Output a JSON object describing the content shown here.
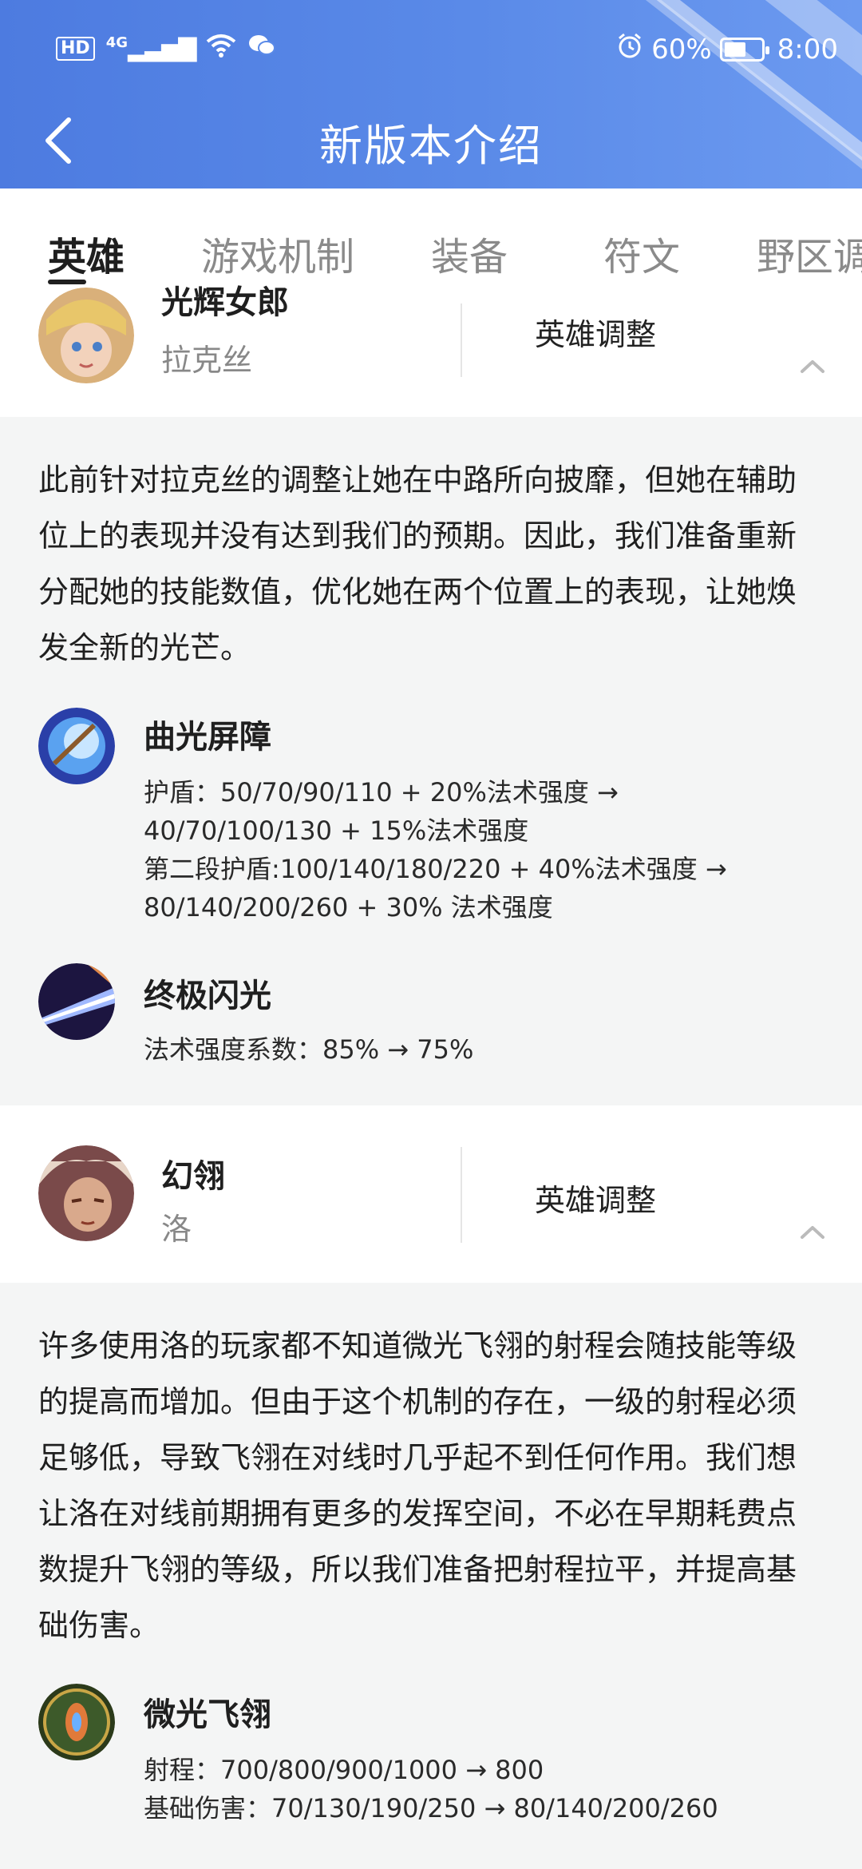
{
  "status_bar": {
    "hd": "HD",
    "network": "4G",
    "battery": "60%",
    "battery_level": 0.6,
    "time": "8:00"
  },
  "nav": {
    "title": "新版本介绍"
  },
  "tabs": [
    {
      "label": "英雄",
      "active": true
    },
    {
      "label": "游戏机制",
      "active": false
    },
    {
      "label": "装备",
      "active": false
    },
    {
      "label": "符文",
      "active": false
    },
    {
      "label": "野区调",
      "active": false
    }
  ],
  "heroes": [
    {
      "title": "光辉女郎",
      "name": "拉克丝",
      "adjust_label": "英雄调整",
      "description": "此前针对拉克丝的调整让她在中路所向披靡，但她在辅助位上的表现并没有达到我们的预期。因此，我们准备重新分配她的技能数值，优化她在两个位置上的表现，让她焕发全新的光芒。",
      "skills": [
        {
          "name": "曲光屏障",
          "details": [
            "护盾：50/70/90/110 + 20%法术强度 →",
            "40/70/100/130 + 15%法术强度",
            "第二段护盾:100/140/180/220 + 40%法术强度 →",
            "80/140/200/260 + 30% 法术强度"
          ]
        },
        {
          "name": "终极闪光",
          "details": [
            "法术强度系数：85% → 75%"
          ]
        }
      ]
    },
    {
      "title": "幻翎",
      "name": "洛",
      "adjust_label": "英雄调整",
      "description": "许多使用洛的玩家都不知道微光飞翎的射程会随技能等级的提高而增加。但由于这个机制的存在，一级的射程必须足够低，导致飞翎在对线时几乎起不到任何作用。我们想让洛在对线前期拥有更多的发挥空间，不必在早期耗费点数提升飞翎的等级，所以我们准备把射程拉平，并提高基础伤害。",
      "skills": [
        {
          "name": "微光飞翎",
          "details": [
            "射程：700/800/900/1000 → 800",
            "基础伤害：70/130/190/250 → 80/140/200/260"
          ]
        }
      ]
    }
  ]
}
